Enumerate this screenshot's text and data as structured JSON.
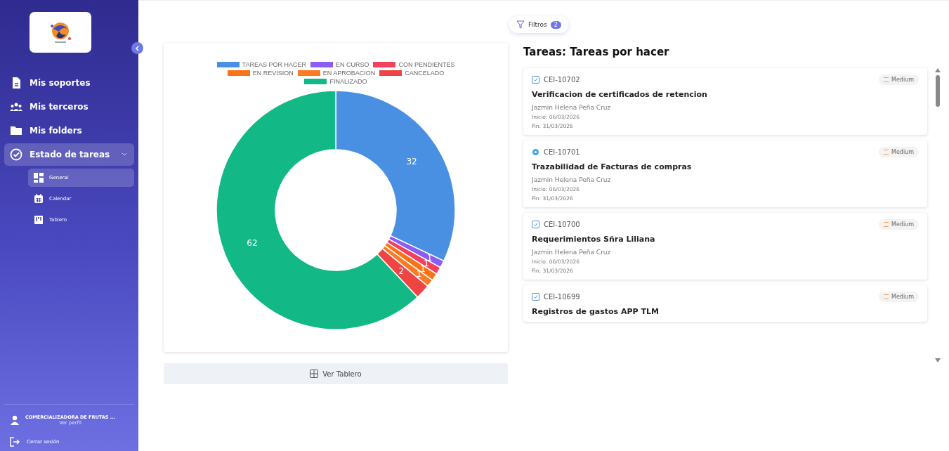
{
  "sidebar": {
    "items": [
      {
        "label": "Mis soportes",
        "selected": false
      },
      {
        "label": "Mis terceros",
        "selected": false
      },
      {
        "label": "Mis folders",
        "selected": false
      },
      {
        "label": "Estado de tareas",
        "selected": true,
        "expanded": true,
        "children": [
          {
            "label": "General",
            "selected": true
          },
          {
            "label": "Calendar",
            "selected": false
          },
          {
            "label": "Tablero",
            "selected": false
          }
        ]
      }
    ],
    "profile": {
      "name": "COMERCIALIZADORA DE FRUTAS ...",
      "link": "Ver perfil"
    },
    "logout": "Cerrar sesión"
  },
  "chart_card": {
    "chart_data": {
      "type": "donut",
      "categories": [
        "TAREAS POR HACER",
        "EN CURSO",
        "CON PENDIENTES",
        "EN REVISION",
        "EN APROBACION",
        "CANCELADO",
        "FINALIZADO"
      ],
      "values": [
        32,
        1,
        1,
        1,
        1,
        2,
        62
      ],
      "colors": [
        "#4a90e2",
        "#8b5cf6",
        "#f43f5e",
        "#f97316",
        "#fb7a24",
        "#ef4444",
        "#12b886"
      ],
      "data_labels": true
    },
    "button": "Ver Tablero"
  },
  "filters": {
    "label": "Filtros",
    "count": "2"
  },
  "tasks": {
    "title": "Tareas: Tareas por hacer",
    "items": [
      {
        "kind": "task",
        "code": "CEI-10702",
        "priority": "Medium",
        "title": "Verificacion de certificados de retencion",
        "assignee": "Jazmin Helena Peña Cruz",
        "start": "Inicio: 06/03/2026",
        "end": "Fin: 31/03/2026"
      },
      {
        "kind": "subtask",
        "code": "CEI-10701",
        "priority": "Medium",
        "title": "Trazabilidad de Facturas de compras",
        "assignee": "Jazmin Helena Peña Cruz",
        "start": "Inicio: 06/03/2026",
        "end": "Fin: 31/03/2026"
      },
      {
        "kind": "task",
        "code": "CEI-10700",
        "priority": "Medium",
        "title": "Requerimientos Sñra Liliana",
        "assignee": "Jazmin Helena Peña Cruz",
        "start": "Inicio: 06/03/2026",
        "end": "Fin: 31/03/2026"
      },
      {
        "kind": "task",
        "code": "CEI-10699",
        "priority": "Medium",
        "title": "Registros de gastos APP TLM"
      }
    ]
  }
}
